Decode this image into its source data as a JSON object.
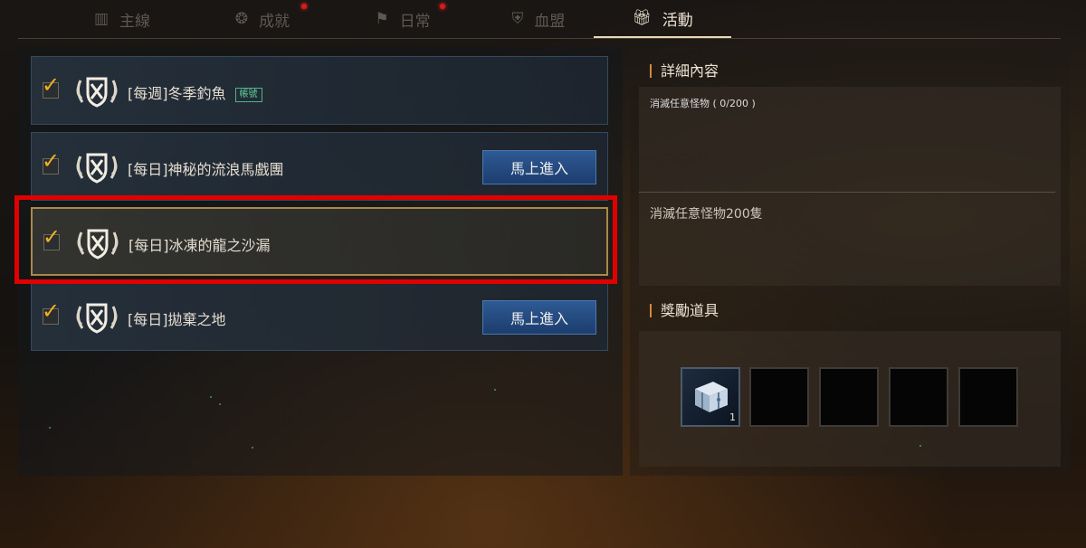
{
  "tabs": [
    {
      "label": "主線",
      "icon": "book-icon",
      "active": false,
      "has_dot": false
    },
    {
      "label": "成就",
      "icon": "medal-icon",
      "active": false,
      "has_dot": true
    },
    {
      "label": "日常",
      "icon": "flag-icon",
      "active": false,
      "has_dot": true
    },
    {
      "label": "血盟",
      "icon": "shield-icon",
      "active": false,
      "has_dot": false
    },
    {
      "label": "活動",
      "icon": "gift-icon",
      "active": true,
      "has_dot": false
    }
  ],
  "quests": [
    {
      "title": "[每週]冬季釣魚",
      "badge": "帳號",
      "button": "",
      "selected": false
    },
    {
      "title": "[每日]神秘的流浪馬戲團",
      "badge": "",
      "button": "馬上進入",
      "selected": false
    },
    {
      "title": "[每日]冰凍的龍之沙漏",
      "badge": "",
      "button": "",
      "selected": true
    },
    {
      "title": "[每日]拋棄之地",
      "badge": "",
      "button": "馬上進入",
      "selected": false
    }
  ],
  "details": {
    "title": "詳細內容",
    "subtitle": "消滅任意怪物 ( 0/200 )",
    "description": "消滅任意怪物200隻"
  },
  "rewards": {
    "title": "獎勵道具",
    "slots": [
      {
        "item": "treasure-chest-icon",
        "count": "1"
      },
      {
        "item": "",
        "count": ""
      },
      {
        "item": "",
        "count": ""
      },
      {
        "item": "",
        "count": ""
      },
      {
        "item": "",
        "count": ""
      }
    ]
  },
  "colors": {
    "accent_gold": "#f0b020",
    "button_blue": "#2f5a94",
    "highlight_red": "#e00000",
    "badge_green": "#5fcf9e"
  }
}
